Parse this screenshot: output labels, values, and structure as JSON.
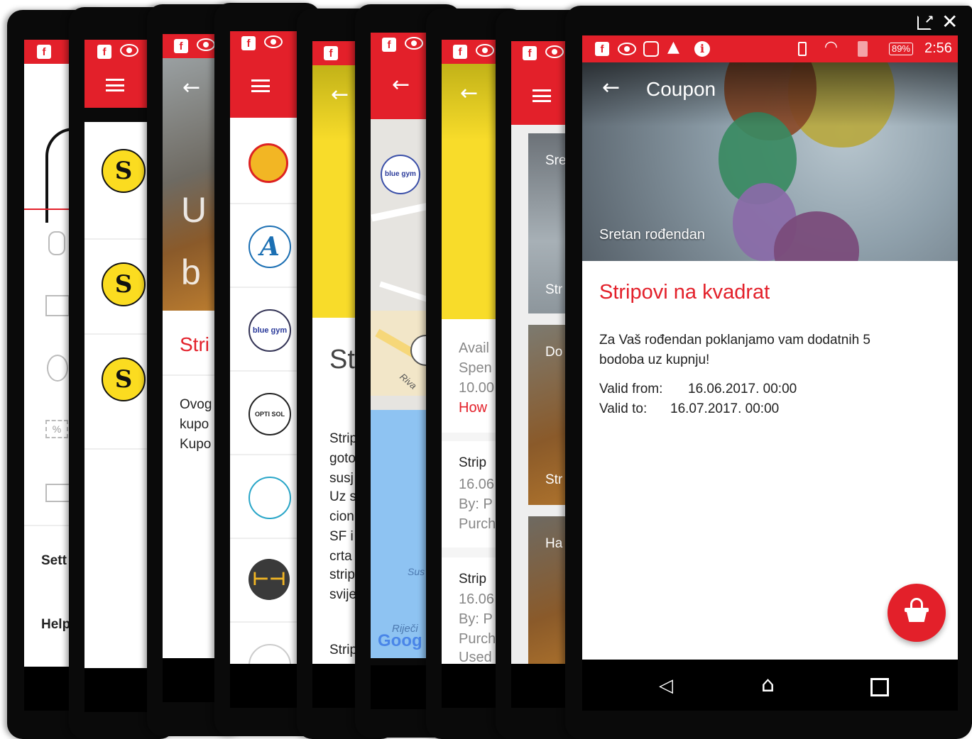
{
  "back_screens": {
    "settings_label": "Sett",
    "help_label": "Help",
    "stri_title": "Stri",
    "coupon_intro_lines": [
      "Ovog",
      "kupo",
      "Kupo"
    ],
    "st_title": "St",
    "st_body_lines": [
      "Strip",
      "goto",
      "susj",
      "Uz s",
      "cion",
      "SF i",
      "crta",
      "strip",
      "svije"
    ],
    "st_footer": "Strip",
    "map_label_riva": "Riva",
    "map_label_sus": "Sus",
    "map_label_rijeci": "Riječi",
    "map_google": "Goog",
    "avail_lines": [
      "Avail",
      "Spen",
      "10.00"
    ],
    "how_link": "How",
    "purchase_items": [
      {
        "title": "Strip",
        "date": "16.06",
        "by": "By: P",
        "purch": "Purch"
      },
      {
        "title": "Strip",
        "date": "16.06",
        "by": "By: P",
        "purch": "Purch",
        "used": "Used"
      }
    ],
    "list_labels": [
      "Sre",
      "Str",
      "Do",
      "Str",
      "Ha"
    ],
    "logo_text_blue": "blue gym",
    "logo_text_opti": "OPTI SOL"
  },
  "front": {
    "status_bar": {
      "battery": "89%",
      "time": "2:56"
    },
    "toolbar": {
      "back_icon": "arrow-left-icon",
      "title": "Coupon"
    },
    "window_controls": {
      "popout_icon": "popout-icon",
      "close_icon": "close-icon"
    },
    "hero_caption": "Sretan rođendan",
    "coupon": {
      "title": "Stripovi na kvadrat",
      "description": "Za Vaš rođendan poklanjamo vam dodatnih 5 bodoba uz kupnju!",
      "valid_from_label": "Valid from:",
      "valid_from_value": "16.06.2017. 00:00",
      "valid_to_label": "Valid to:",
      "valid_to_value": "16.07.2017. 00:00"
    },
    "fab_icon": "basket-icon",
    "nav_icons": [
      "back-triangle-icon",
      "home-icon",
      "recents-square-icon"
    ],
    "colors": {
      "brand_red": "#e3202a",
      "accent_yellow": "#f8dc2a"
    }
  }
}
